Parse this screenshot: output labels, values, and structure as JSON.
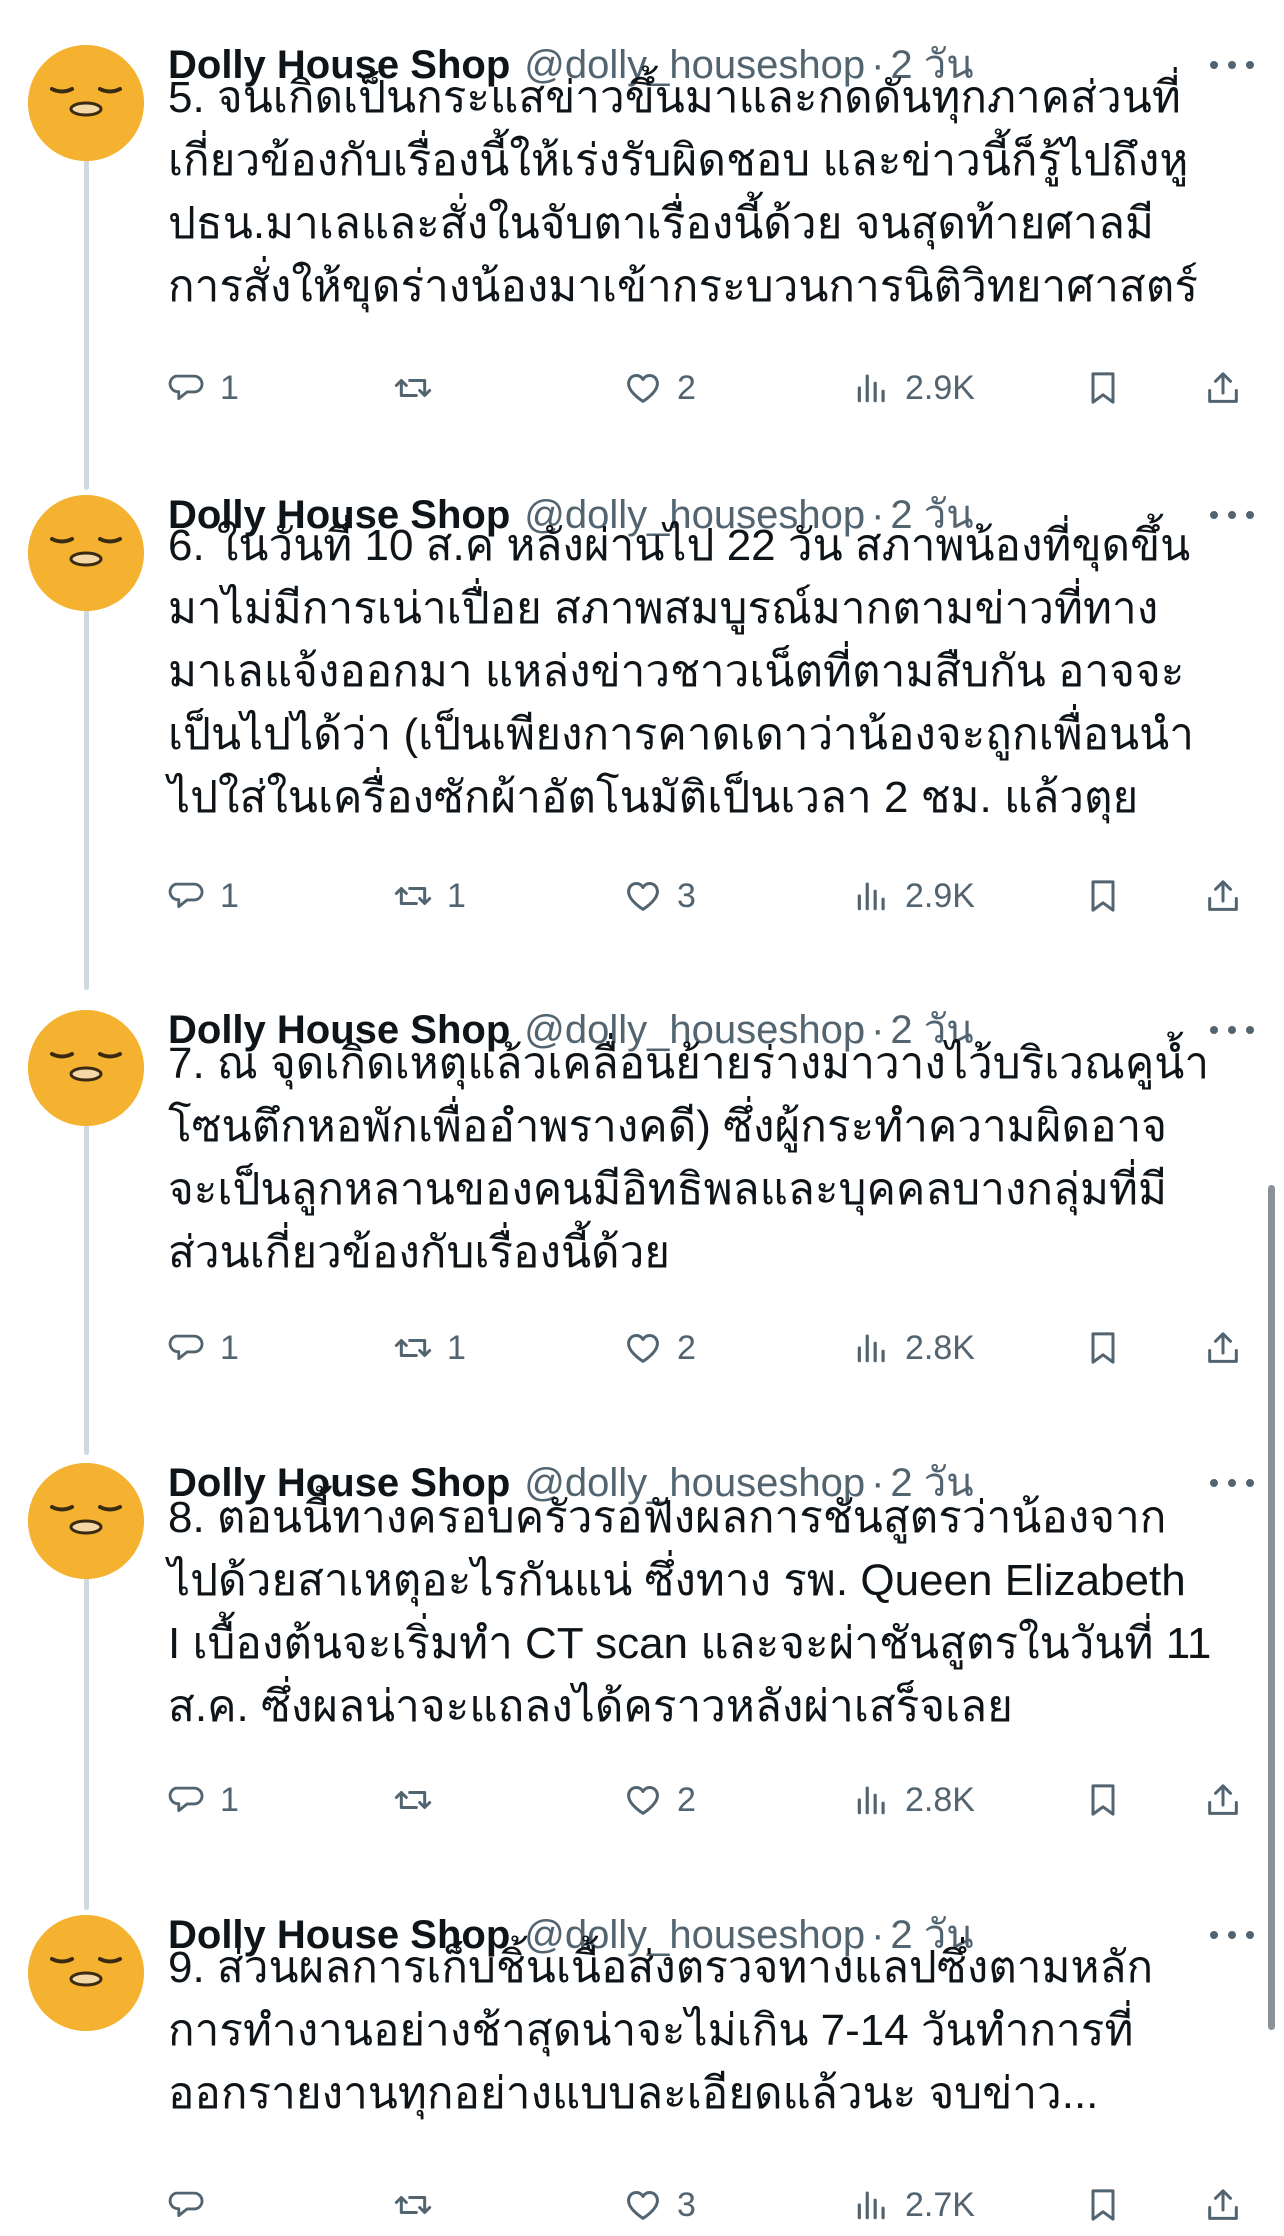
{
  "tweets": [
    {
      "author_name": "Dolly House Shop",
      "handle": "@dolly_houseshop",
      "separator": "·",
      "time": "2 วัน",
      "text": "5. จนเกิดเป็นกระแสข่าวขึ้นมาและกดดันทุกภาคส่วนที่\nเกี่ยวข้องกับเรื่องนี้ให้เร่งรับผิดชอบ และข่าวนี้ก็รู้ไปถึงหู\nปธน.มาเลและสั่งในจับตาเรื่องนี้ด้วย จนสุดท้ายศาลมี\nการสั่งให้ขุดร่างน้องมาเข้ากระบวนการนิติวิทยาศาสตร์",
      "replies": "1",
      "retweets": "",
      "likes": "2",
      "views": "2.9K"
    },
    {
      "author_name": "Dolly House Shop",
      "handle": "@dolly_houseshop",
      "separator": "·",
      "time": "2 วัน",
      "text": "6. ในวันที่ 10 ส.ค หลังผ่านไป 22 วัน สภาพน้องที่ขุดขึ้น\nมาไม่มีการเน่าเปื่อย สภาพสมบูรณ์มากตามข่าวที่ทาง\nมาเลแจ้งออกมา แหล่งข่าวชาวเน็ตที่ตามสืบกัน อาจจะ\nเป็นไปได้ว่า (เป็นเพียงการคาดเดาว่าน้องจะถูกเพื่อนนำ\nไปใส่ในเครื่องซักผ้าอัตโนมัติเป็นเวลา 2 ชม. แล้วตุย",
      "replies": "1",
      "retweets": "1",
      "likes": "3",
      "views": "2.9K"
    },
    {
      "author_name": "Dolly House Shop",
      "handle": "@dolly_houseshop",
      "separator": "·",
      "time": "2 วัน",
      "text": "7. ณ จุดเกิดเหตุแล้วเคลื่อนย้ายร่างมาวางไว้บริเวณคูน้ำ\nโซนตึกหอพักเพื่ออำพรางคดี) ซึ่งผู้กระทำความผิดอาจ\nจะเป็นลูกหลานของคนมีอิทธิพลและบุคคลบางกลุ่มที่มี\nส่วนเกี่ยวข้องกับเรื่องนี้ด้วย",
      "replies": "1",
      "retweets": "1",
      "likes": "2",
      "views": "2.8K"
    },
    {
      "author_name": "Dolly House Shop",
      "handle": "@dolly_houseshop",
      "separator": "·",
      "time": "2 วัน",
      "text": "8. ตอนนี้ทางครอบครัวรอฟังผลการชันสูตรว่าน้องจาก\nไปด้วยสาเหตุอะไรกันแน่ ซึ่งทาง รพ. Queen Elizabeth\nI เบื้องต้นจะเริ่มทำ CT scan และจะผ่าชันสูตรในวันที่ 11\nส.ค. ซึ่งผลน่าจะแถลงได้คราวหลังผ่าเสร็จเลย",
      "replies": "1",
      "retweets": "",
      "likes": "2",
      "views": "2.8K"
    },
    {
      "author_name": "Dolly House Shop",
      "handle": "@dolly_houseshop",
      "separator": "·",
      "time": "2 วัน",
      "text": "9. ส่วนผลการเก็บชิ้นเนื้อส่งตรวจทางแลปซึ่งตามหลัก\nการทำงานอย่างช้าสุดน่าจะไม่เกิน 7-14 วันทำการที่\nออกรายงานทุกอย่างแบบละเอียดแล้วนะ จบข่าว...",
      "replies": "",
      "retweets": "",
      "likes": "3",
      "views": "2.7K"
    }
  ],
  "icons": {
    "avatar": "gudetama-avatar-icon",
    "more": "more-dots-icon",
    "reply": "reply-bubble-icon",
    "retweet": "retweet-arrows-icon",
    "like": "heart-icon",
    "views": "views-bars-icon",
    "bookmark": "bookmark-icon",
    "share": "share-upload-icon"
  },
  "colors": {
    "text": "#0f1419",
    "muted": "#536471",
    "thread_line": "#cfd9de",
    "avatar_bg": "#f5b230",
    "background": "#ffffff"
  }
}
